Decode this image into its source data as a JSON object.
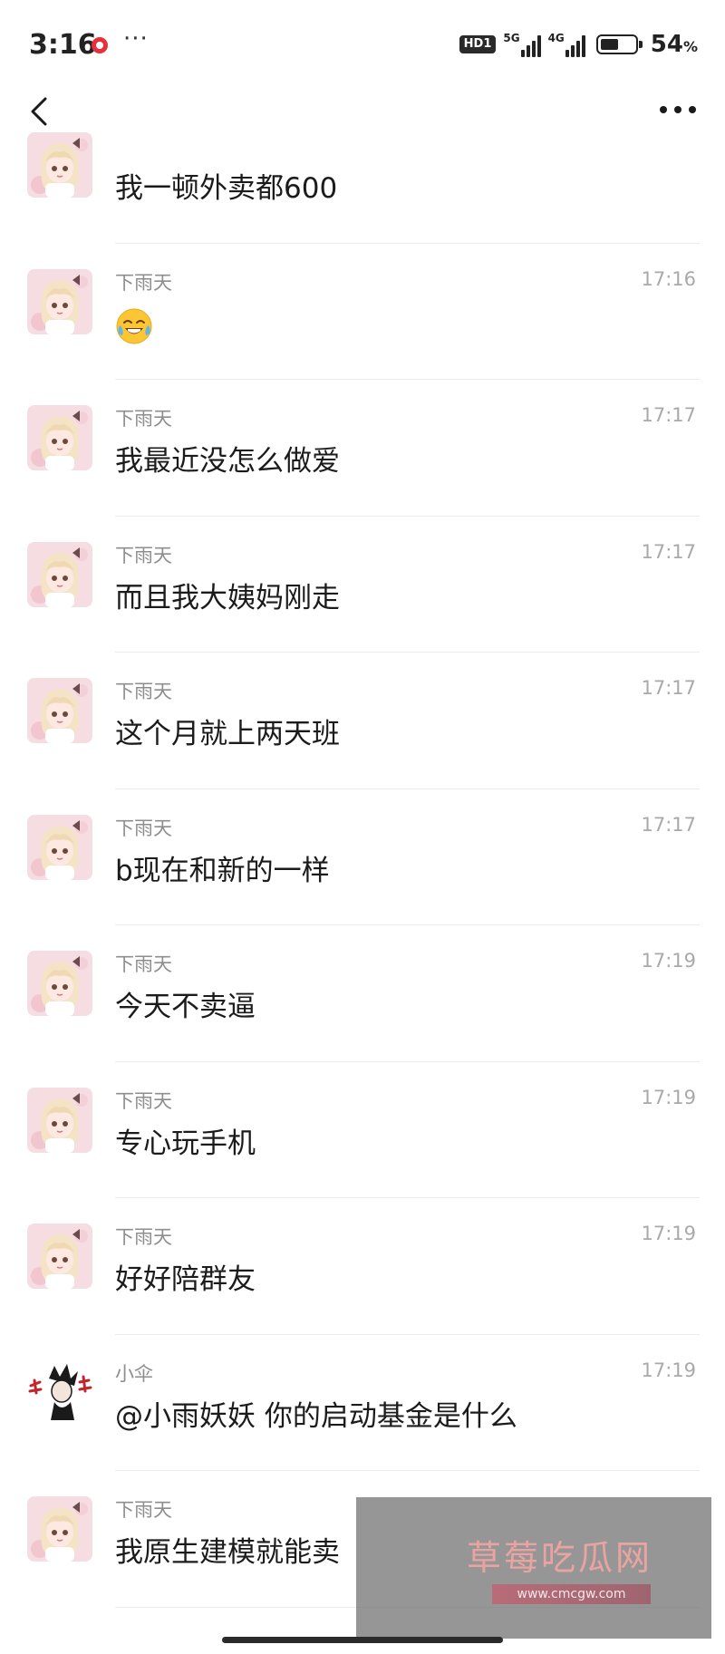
{
  "status_bar": {
    "time": "3:16",
    "more": "···",
    "hd_badge": "HD1",
    "net1": "5G",
    "net2": "4G",
    "battery_level": 0.54,
    "battery_text": "54",
    "battery_unit": "%"
  },
  "nav": {
    "back_icon": "chevron-left-icon",
    "more_icon": "more-dots-icon"
  },
  "messages": [
    {
      "sender": "",
      "time": "",
      "text": "我一顿外卖都600",
      "avatar": "anime-girl"
    },
    {
      "sender": "下雨天",
      "time": "17:16",
      "text": "",
      "emoji": "laughing-tears-emoji",
      "avatar": "anime-girl"
    },
    {
      "sender": "下雨天",
      "time": "17:17",
      "text": "我最近没怎么做爱",
      "avatar": "anime-girl"
    },
    {
      "sender": "下雨天",
      "time": "17:17",
      "text": "而且我大姨妈刚走",
      "avatar": "anime-girl"
    },
    {
      "sender": "下雨天",
      "time": "17:17",
      "text": "这个月就上两天班",
      "avatar": "anime-girl"
    },
    {
      "sender": "下雨天",
      "time": "17:17",
      "text": "b现在和新的一样",
      "avatar": "anime-girl"
    },
    {
      "sender": "下雨天",
      "time": "17:19",
      "text": "今天不卖逼",
      "avatar": "anime-girl"
    },
    {
      "sender": "下雨天",
      "time": "17:19",
      "text": "专心玩手机",
      "avatar": "anime-girl"
    },
    {
      "sender": "下雨天",
      "time": "17:19",
      "text": "好好陪群友",
      "avatar": "anime-girl"
    },
    {
      "sender": "小伞",
      "time": "17:19",
      "text": "@小雨妖妖 你的启动基金是什么",
      "avatar": "ink-character"
    },
    {
      "sender": "下雨天",
      "time": "",
      "text": "我原生建模就能卖",
      "avatar": "anime-girl"
    }
  ],
  "watermark": {
    "logo": "草莓吃瓜网",
    "url": "www.cmcgw.com"
  },
  "colors": {
    "background": "#ffffff",
    "sender": "#8e8e8e",
    "time": "#a9a9a9",
    "text": "#1b1b1b",
    "divider": "#ececec"
  }
}
